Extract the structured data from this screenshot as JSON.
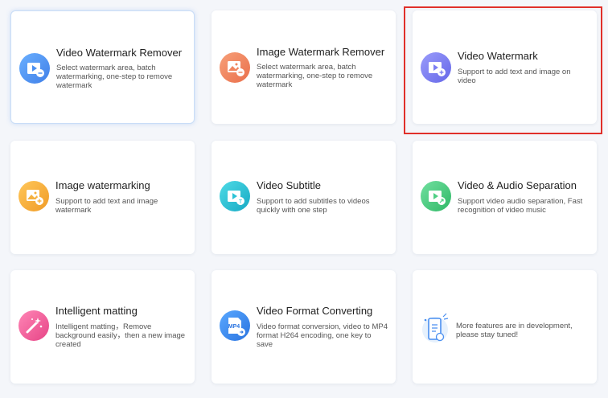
{
  "cards": [
    {
      "title": "Video Watermark Remover",
      "desc": "Select watermark area, batch watermarking, one-step to remove watermark",
      "icon": "video-watermark-remover-icon"
    },
    {
      "title": "Image Watermark Remover",
      "desc": "Select watermark area, batch watermarking, one-step to remove watermark",
      "icon": "image-watermark-remover-icon"
    },
    {
      "title": "Video Watermark",
      "desc": "Support to add text and image on video",
      "icon": "video-watermark-icon"
    },
    {
      "title": "Image watermarking",
      "desc": "Support to add text and image watermark",
      "icon": "image-watermarking-icon"
    },
    {
      "title": "Video Subtitle",
      "desc": "Support to add subtitles to videos quickly with one step",
      "icon": "video-subtitle-icon"
    },
    {
      "title": "Video & Audio Separation",
      "desc": "Support video audio separation, Fast recognition of video music",
      "icon": "video-audio-separation-icon"
    },
    {
      "title": "Intelligent matting",
      "desc": "Intelligent matting，Remove background easily，then a new image created",
      "icon": "intelligent-matting-icon"
    },
    {
      "title": "Video Format Converting",
      "desc": "Video format conversion, video to MP4 format H264 encoding, one key to save",
      "icon": "video-format-converting-icon",
      "badge": "MP4"
    }
  ],
  "development": {
    "text": "More features are in development, please stay tuned!",
    "icon": "in-development-icon"
  },
  "colors": {
    "blue": "#4a8ff0",
    "orange": "#f0845e",
    "purple": "#7d7ff2",
    "yellow": "#f5b13f",
    "cyan": "#2cc3d6",
    "green": "#4fcf84",
    "pink": "#f0609a",
    "highlight": "#e0302a"
  }
}
